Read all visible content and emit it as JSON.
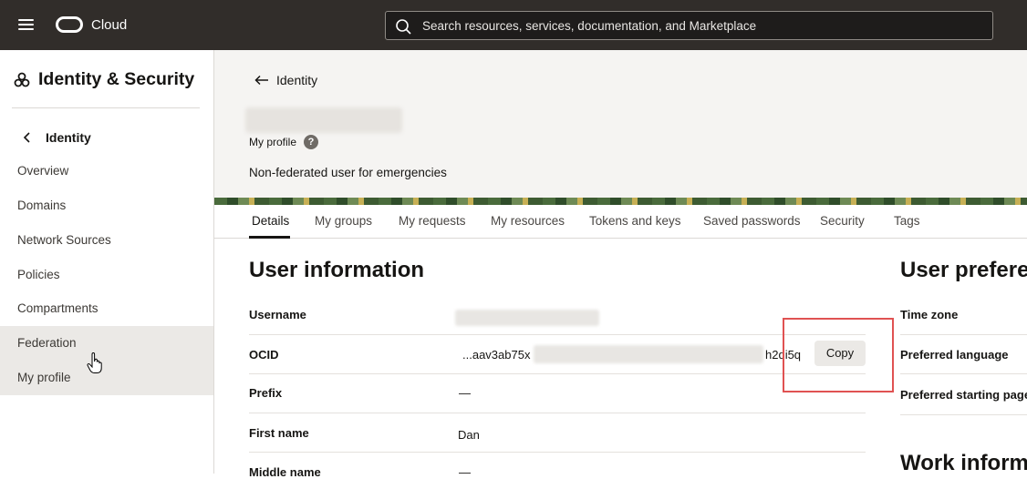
{
  "topbar": {
    "brand": "Cloud",
    "search_placeholder": "Search resources, services, documentation, and Marketplace"
  },
  "sidebar": {
    "title": "Identity & Security",
    "back_label": "Identity",
    "items": [
      {
        "label": "Overview"
      },
      {
        "label": "Domains"
      },
      {
        "label": "Network Sources"
      },
      {
        "label": "Policies"
      },
      {
        "label": "Compartments"
      },
      {
        "label": "Federation"
      },
      {
        "label": "My profile"
      }
    ]
  },
  "header": {
    "back_link": "Identity",
    "profile_label": "My profile",
    "description": "Non-federated user for emergencies"
  },
  "tabs": [
    "Details",
    "My groups",
    "My requests",
    "My resources",
    "Tokens and keys",
    "Saved passwords",
    "Security",
    "Tags"
  ],
  "user_info": {
    "heading": "User information",
    "rows": [
      {
        "label": "Username",
        "value": ""
      },
      {
        "label": "OCID",
        "value_start": "...aav3ab75x",
        "value_end": "h2di5q"
      },
      {
        "label": "Prefix",
        "value": "—"
      },
      {
        "label": "First name",
        "value": "Dan"
      },
      {
        "label": "Middle name",
        "value": "—"
      }
    ],
    "copy_label": "Copy"
  },
  "preferences": {
    "heading": "User prefere",
    "rows": [
      "Time zone",
      "Preferred language",
      "Preferred starting page"
    ]
  },
  "work": {
    "heading": "Work inform"
  },
  "colors": {
    "topbar": "#312d2a",
    "highlight": "#e05252"
  }
}
